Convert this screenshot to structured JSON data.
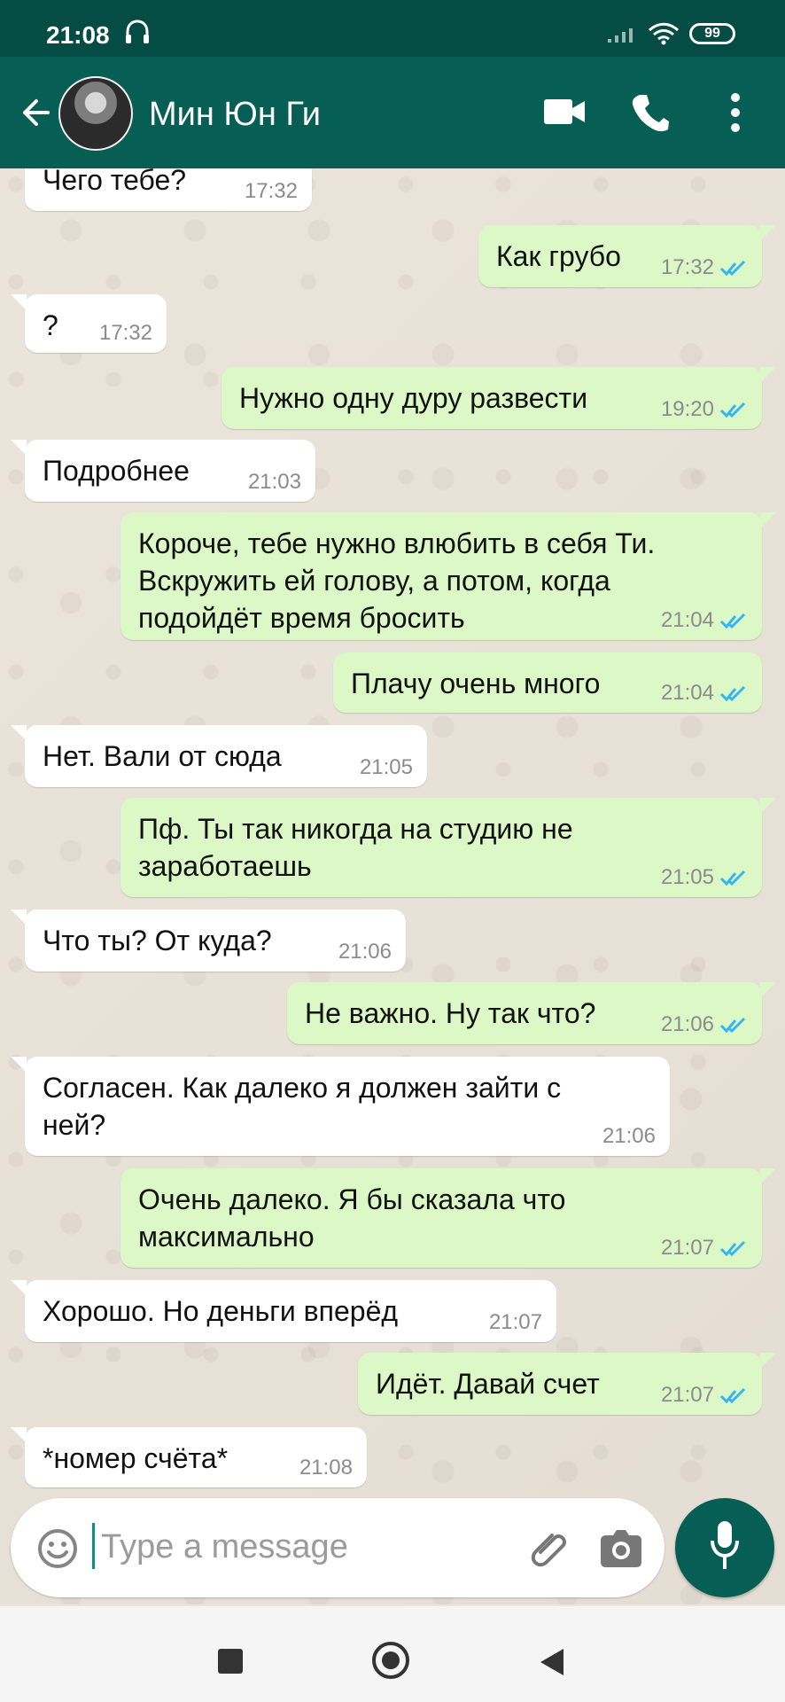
{
  "status": {
    "time": "21:08",
    "battery": "99"
  },
  "header": {
    "contact_name": "Мин Юн Ги"
  },
  "composer": {
    "placeholder": "Type a message"
  },
  "messages": [
    {
      "direction": "in",
      "text": "Чего тебе?",
      "time": "17:32"
    },
    {
      "direction": "out",
      "text": "Как грубо",
      "time": "17:32"
    },
    {
      "direction": "in",
      "text": "?",
      "time": "17:32"
    },
    {
      "direction": "out",
      "text": "Нужно одну дуру развести",
      "time": "19:20"
    },
    {
      "direction": "in",
      "text": "Подробнее",
      "time": "21:03"
    },
    {
      "direction": "out",
      "text": "Короче, тебе нужно влюбить в себя Ти.\nВскружить ей голову, а потом, когда\nподойдёт время бросить",
      "time": "21:04"
    },
    {
      "direction": "out",
      "text": "Плачу очень много",
      "time": "21:04"
    },
    {
      "direction": "in",
      "text": "Нет. Вали от сюда",
      "time": "21:05"
    },
    {
      "direction": "out",
      "text": "Пф. Ты так никогда на студию не\nзаработаешь",
      "time": "21:05"
    },
    {
      "direction": "in",
      "text": "Что ты? От куда?",
      "time": "21:06"
    },
    {
      "direction": "out",
      "text": "Не важно. Ну так что?",
      "time": "21:06"
    },
    {
      "direction": "in",
      "text": "Согласен. Как далеко я должен зайти с\nней?",
      "time": "21:06"
    },
    {
      "direction": "out",
      "text": "Очень далеко. Я бы сказала что\nмаксимально",
      "time": "21:07"
    },
    {
      "direction": "in",
      "text": "Хорошо. Но деньги вперёд",
      "time": "21:07"
    },
    {
      "direction": "out",
      "text": "Идёт. Давай счет",
      "time": "21:07"
    },
    {
      "direction": "in",
      "text": "*номер счёта*",
      "time": "21:08"
    }
  ],
  "icons": {
    "back": "arrow-left-icon",
    "video": "video-camera-icon",
    "call": "phone-icon",
    "menu": "more-vertical-icon",
    "emoji": "emoji-icon",
    "attach": "paperclip-icon",
    "camera": "camera-icon",
    "mic": "microphone-icon"
  },
  "colors": {
    "header": "#075e54",
    "status_bar": "#054d44",
    "incoming_bubble": "#ffffff",
    "outgoing_bubble": "#dcf8c6",
    "read_ticks": "#34b7f1"
  }
}
